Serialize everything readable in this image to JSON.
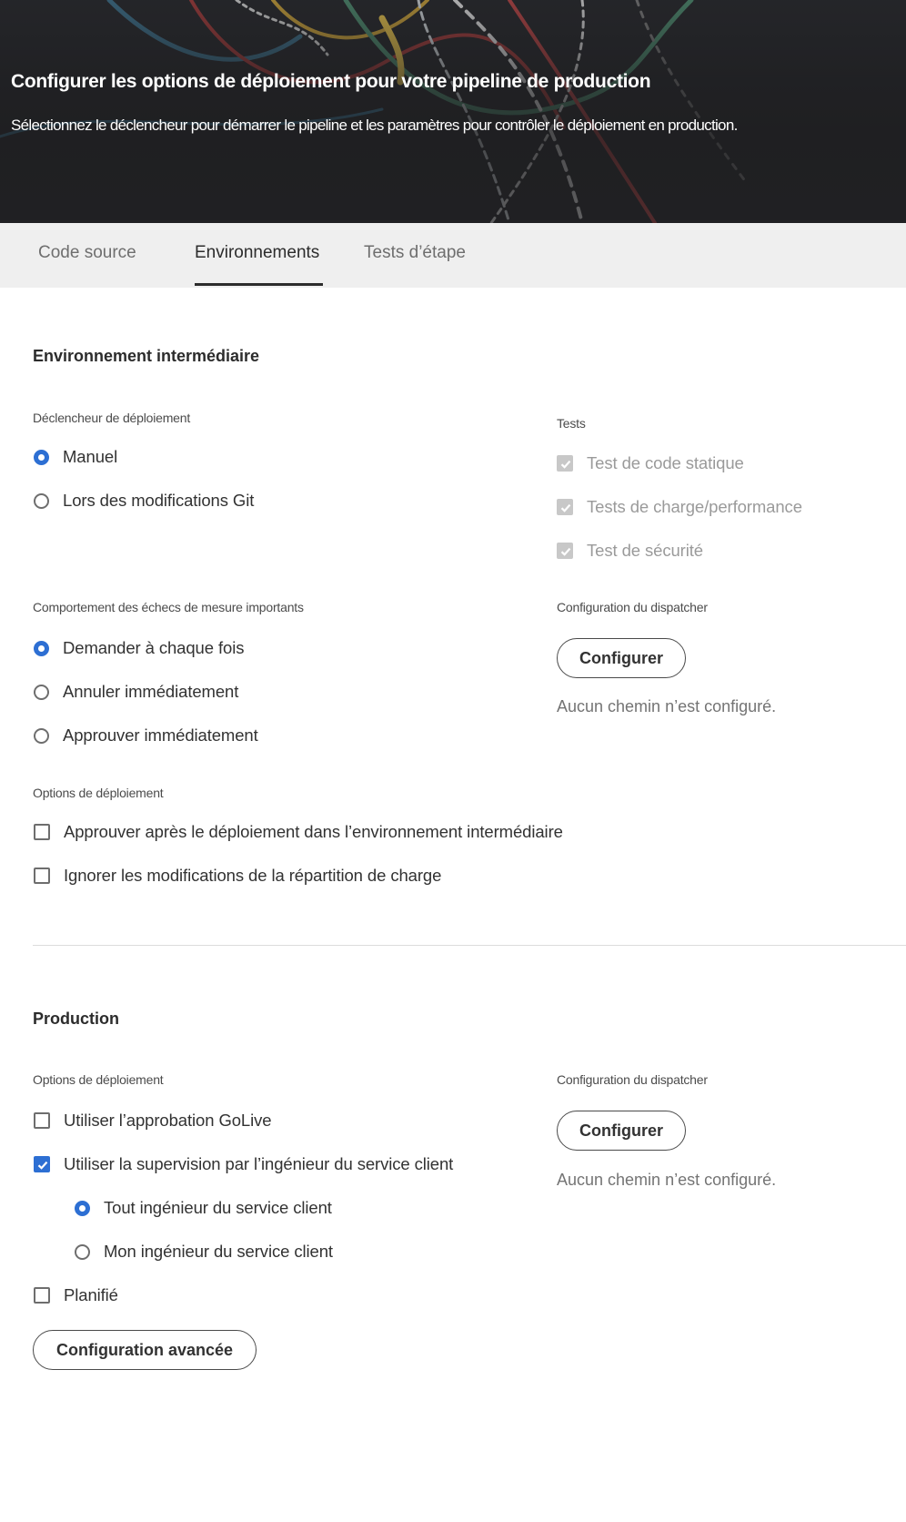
{
  "header": {
    "title": "Configurer les options de déploiement pour votre pipeline de production",
    "subtitle": "Sélectionnez le déclencheur pour démarrer le pipeline et les paramètres pour contrôler le déploiement en production."
  },
  "tabs": [
    {
      "label": "Code source",
      "active": false
    },
    {
      "label": "Environnements",
      "active": true
    },
    {
      "label": "Tests d’étape",
      "active": false
    }
  ],
  "staging": {
    "title": "Environnement intermédiaire",
    "trigger": {
      "label": "Déclencheur de déploiement",
      "options": [
        {
          "label": "Manuel",
          "selected": true
        },
        {
          "label": "Lors des modifications Git",
          "selected": false
        }
      ]
    },
    "tests": {
      "label": "Tests",
      "items": [
        {
          "label": "Test de code statique",
          "checked": true,
          "disabled": true
        },
        {
          "label": "Tests de charge/performance",
          "checked": true,
          "disabled": true
        },
        {
          "label": "Test de sécurité",
          "checked": true,
          "disabled": true
        }
      ]
    },
    "failure_behavior": {
      "label": "Comportement des échecs de mesure importants",
      "options": [
        {
          "label": "Demander à chaque fois",
          "selected": true
        },
        {
          "label": "Annuler immédiatement",
          "selected": false
        },
        {
          "label": "Approuver immédiatement",
          "selected": false
        }
      ]
    },
    "dispatcher": {
      "label": "Configuration du dispatcher",
      "button": "Configurer",
      "hint": "Aucun chemin n’est configuré."
    },
    "deploy_options": {
      "label": "Options de déploiement",
      "items": [
        {
          "label": "Approuver après le déploiement dans l’environnement intermédiaire",
          "checked": false
        },
        {
          "label": "Ignorer les modifications de la répartition de charge",
          "checked": false
        }
      ]
    }
  },
  "production": {
    "title": "Production",
    "deploy_options": {
      "label": "Options de déploiement",
      "golive": {
        "label": "Utiliser l’approbation GoLive",
        "checked": false
      },
      "cse": {
        "label": "Utiliser la supervision par l’ingénieur du service client",
        "checked": true
      },
      "cse_options": [
        {
          "label": "Tout ingénieur du service client",
          "selected": true
        },
        {
          "label": "Mon ingénieur du service client",
          "selected": false
        }
      ],
      "scheduled": {
        "label": "Planifié",
        "checked": false
      }
    },
    "advanced_button": "Configuration avancée",
    "dispatcher": {
      "label": "Configuration du dispatcher",
      "button": "Configurer",
      "hint": "Aucun chemin n’est configuré."
    }
  },
  "colors": {
    "accent": "#2d6fd3",
    "banner_bg": "#26272b",
    "tabbar_bg": "#efefef"
  }
}
